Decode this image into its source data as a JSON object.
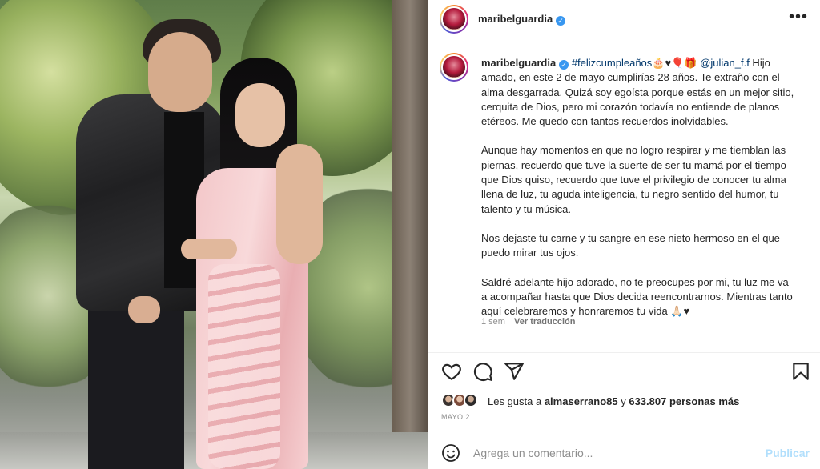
{
  "post": {
    "username": "maribelguardia",
    "verified_icon": "verified-badge-icon",
    "more_icon": "more-options-icon"
  },
  "caption": {
    "username": "maribelguardia",
    "hashtag": "#felizcumpleaños",
    "emojis_after_hashtag": "🎂♥🎈🎁",
    "mention": "@julian_f.f",
    "paragraphs": [
      " Hijo amado, en este 2 de mayo cumplirías 28 años. Te extraño con el alma desgarrada. Quizá soy egoísta porque estás en un mejor sitio, cerquita de Dios, pero mi corazón todavía no entiende de planos etéreos. Me quedo con tantos recuerdos inolvidables.",
      "Aunque hay momentos en que no logro respirar y me tiemblan las piernas, recuerdo que tuve la suerte de ser tu mamá por el tiempo que Dios quiso, recuerdo que tuve el privilegio de conocer tu alma llena de luz, tu aguda inteligencia, tu negro sentido del humor, tu talento y tu música.",
      "Nos dejaste tu carne y tu sangre en ese nieto hermoso en el que puedo mirar tus ojos.",
      "Saldré adelante hijo adorado, no te preocupes por mi, tu luz me va a acompañar hasta que Dios decida reencontrarnos. Mientras tanto aquí celebraremos y honraremos tu vida 🙏🏻♥"
    ],
    "time_ago": "1 sem",
    "translate_label": "Ver traducción"
  },
  "actions": {
    "like_icon": "heart-icon",
    "comment_icon": "comment-icon",
    "share_icon": "share-icon",
    "save_icon": "bookmark-icon"
  },
  "likes": {
    "prefix": "Les gusta a ",
    "user": "almaserrano85",
    "middle": " y ",
    "count": "633.807 personas más"
  },
  "date": "MAYO 2",
  "composer": {
    "placeholder": "Agrega un comentario...",
    "publish_label": "Publicar",
    "emoji_icon": "smiley-icon"
  },
  "colors": {
    "link": "#00376b",
    "verified": "#3897f0",
    "publish_disabled": "#b2dffc",
    "muted": "#8e8e8e"
  }
}
